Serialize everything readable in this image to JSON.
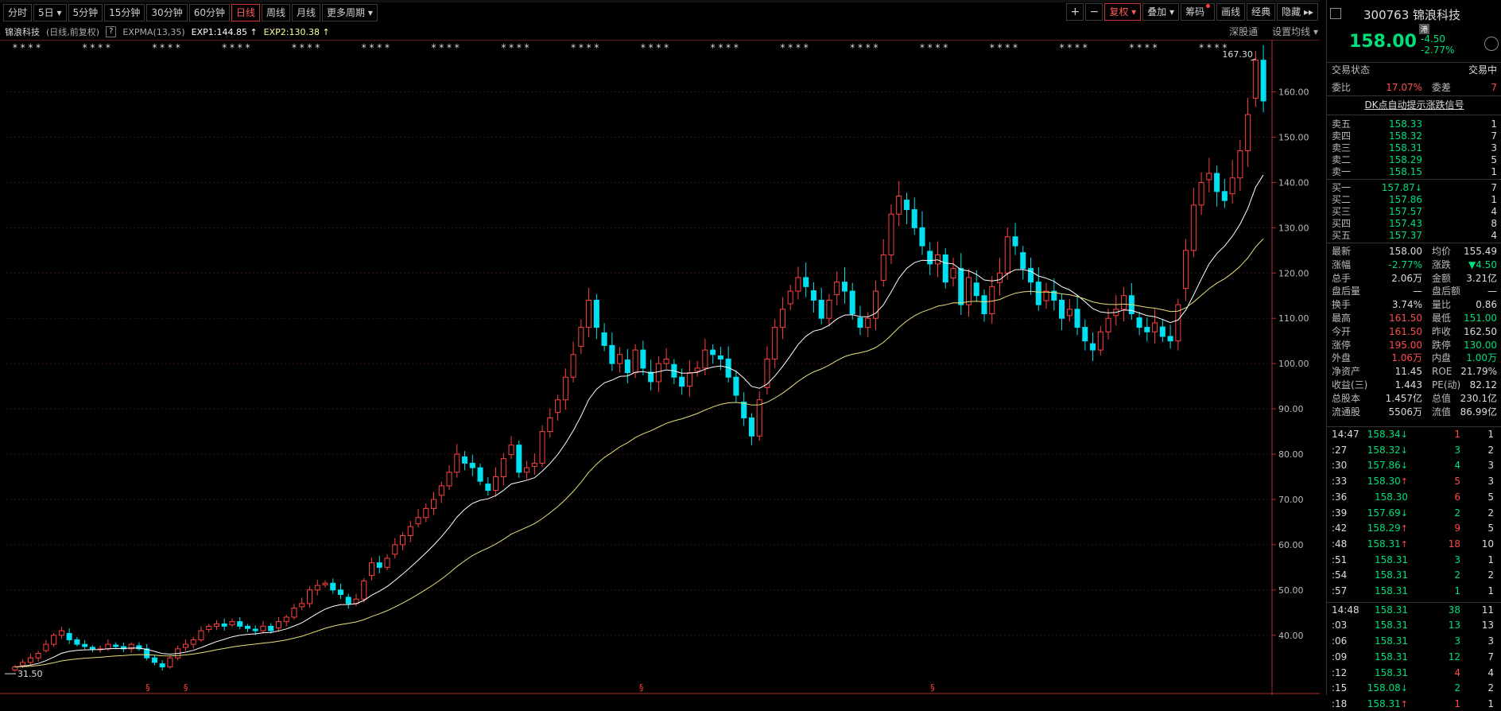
{
  "toolbar": {
    "periods": [
      "分时",
      "5日",
      "5分钟",
      "15分钟",
      "30分钟",
      "60分钟",
      "日线",
      "周线",
      "月线",
      "更多周期"
    ],
    "active_period": "日线",
    "right_buttons": [
      "复权",
      "叠加",
      "筹码",
      "画线",
      "经典",
      "隐藏"
    ]
  },
  "infobar": {
    "name": "锦浪科技",
    "meta": "(日线,前复权)",
    "help": "?",
    "indicator": "EXPMA(13,35)",
    "exp1": "EXP1:144.85",
    "exp2": "EXP2:130.38",
    "right_links": [
      "深股通",
      "设置均线"
    ]
  },
  "quote": {
    "code": "300763",
    "name": "锦浪科技",
    "hk_tag": "港",
    "price": "158.00",
    "change": "-4.50",
    "change_pct": "-2.77%"
  },
  "status": {
    "label": "交易状态",
    "value": "交易中"
  },
  "weibi": {
    "label1": "委比",
    "value1": "17.07%",
    "label2": "委差",
    "value2": "7"
  },
  "signal": "DK点自动提示涨跌信号",
  "sells": [
    {
      "label": "卖五",
      "price": "158.33",
      "vol": "1"
    },
    {
      "label": "卖四",
      "price": "158.32",
      "vol": "7"
    },
    {
      "label": "卖三",
      "price": "158.31",
      "vol": "3"
    },
    {
      "label": "卖二",
      "price": "158.29",
      "vol": "5"
    },
    {
      "label": "卖一",
      "price": "158.15",
      "vol": "1"
    }
  ],
  "buys": [
    {
      "label": "买一",
      "price": "157.87",
      "vol": "7",
      "arrow": "↓"
    },
    {
      "label": "买二",
      "price": "157.86",
      "vol": "1",
      "arrow": ""
    },
    {
      "label": "买三",
      "price": "157.57",
      "vol": "4",
      "arrow": ""
    },
    {
      "label": "买四",
      "price": "157.43",
      "vol": "8",
      "arrow": ""
    },
    {
      "label": "买五",
      "price": "157.37",
      "vol": "4",
      "arrow": ""
    }
  ],
  "stats": [
    [
      "最新",
      "158.00",
      "均价",
      "155.49"
    ],
    [
      "涨幅",
      "-2.77%",
      "涨跌",
      "▼4.50"
    ],
    [
      "总手",
      "2.06万",
      "金额",
      "3.21亿"
    ],
    [
      "盘后量",
      "—",
      "盘后额",
      "—"
    ],
    [
      "换手",
      "3.74%",
      "量比",
      "0.86"
    ],
    [
      "最高",
      "161.50",
      "最低",
      "151.00"
    ],
    [
      "今开",
      "161.50",
      "昨收",
      "162.50"
    ],
    [
      "涨停",
      "195.00",
      "跌停",
      "130.00"
    ],
    [
      "外盘",
      "1.06万",
      "内盘",
      "1.00万"
    ],
    [
      "净资产",
      "11.45",
      "ROE",
      "21.79%"
    ],
    [
      "收益(三)",
      "1.443",
      "PE(动)",
      "82.12"
    ],
    [
      "总股本",
      "1.457亿",
      "总值",
      "230.1亿"
    ],
    [
      "流通股",
      "5506万",
      "流值",
      "86.99亿"
    ]
  ],
  "stat_colors": [
    [
      "w",
      "w"
    ],
    [
      "g",
      "g"
    ],
    [
      "w",
      "w"
    ],
    [
      "w",
      "w"
    ],
    [
      "w",
      "w"
    ],
    [
      "r",
      "g"
    ],
    [
      "r",
      "w"
    ],
    [
      "r",
      "g"
    ],
    [
      "r",
      "g"
    ],
    [
      "w",
      "w"
    ],
    [
      "w",
      "w"
    ],
    [
      "w",
      "w"
    ],
    [
      "w",
      "w"
    ]
  ],
  "ticks1": [
    {
      "t": "14:47",
      "p": "158.34",
      "a": "↓",
      "v": "1",
      "n": "1",
      "pc": "g",
      "vc": "r"
    },
    {
      "t": ":27",
      "p": "158.32",
      "a": "↓",
      "v": "3",
      "n": "2",
      "pc": "g",
      "vc": "g"
    },
    {
      "t": ":30",
      "p": "157.86",
      "a": "↓",
      "v": "4",
      "n": "3",
      "pc": "g",
      "vc": "g"
    },
    {
      "t": ":33",
      "p": "158.30",
      "a": "↑",
      "v": "5",
      "n": "3",
      "pc": "g",
      "vc": "r"
    },
    {
      "t": ":36",
      "p": "158.30",
      "a": "",
      "v": "6",
      "n": "5",
      "pc": "g",
      "vc": "r"
    },
    {
      "t": ":39",
      "p": "157.69",
      "a": "↓",
      "v": "2",
      "n": "2",
      "pc": "g",
      "vc": "g"
    },
    {
      "t": ":42",
      "p": "158.29",
      "a": "↑",
      "v": "9",
      "n": "5",
      "pc": "g",
      "vc": "r"
    },
    {
      "t": ":48",
      "p": "158.31",
      "a": "↑",
      "v": "18",
      "n": "10",
      "pc": "g",
      "vc": "r"
    },
    {
      "t": ":51",
      "p": "158.31",
      "a": "",
      "v": "3",
      "n": "1",
      "pc": "g",
      "vc": "g"
    },
    {
      "t": ":54",
      "p": "158.31",
      "a": "",
      "v": "2",
      "n": "2",
      "pc": "g",
      "vc": "g"
    },
    {
      "t": ":57",
      "p": "158.31",
      "a": "",
      "v": "1",
      "n": "1",
      "pc": "g",
      "vc": "g"
    }
  ],
  "ticks2": [
    {
      "t": "14:48",
      "p": "158.31",
      "a": "",
      "v": "38",
      "n": "11",
      "pc": "g",
      "vc": "g"
    },
    {
      "t": ":03",
      "p": "158.31",
      "a": "",
      "v": "13",
      "n": "13",
      "pc": "g",
      "vc": "g"
    },
    {
      "t": ":06",
      "p": "158.31",
      "a": "",
      "v": "3",
      "n": "3",
      "pc": "g",
      "vc": "g"
    },
    {
      "t": ":09",
      "p": "158.31",
      "a": "",
      "v": "12",
      "n": "7",
      "pc": "g",
      "vc": "g"
    },
    {
      "t": ":12",
      "p": "158.31",
      "a": "",
      "v": "4",
      "n": "4",
      "pc": "g",
      "vc": "r"
    },
    {
      "t": ":15",
      "p": "158.08",
      "a": "↓",
      "v": "2",
      "n": "2",
      "pc": "g",
      "vc": "g"
    },
    {
      "t": ":18",
      "p": "158.31",
      "a": "↑",
      "v": "1",
      "n": "1",
      "pc": "g",
      "vc": "r"
    }
  ],
  "chart_data": {
    "type": "candlestick",
    "title": "锦浪科技",
    "yticks": [
      40,
      50,
      60,
      70,
      80,
      90,
      100,
      110,
      120,
      130,
      140,
      150,
      160
    ],
    "ylim": [
      31,
      168
    ],
    "high_label": "167.30",
    "low_label": "31.50",
    "closes": [
      33,
      34,
      35,
      36,
      38,
      40,
      41,
      39,
      38,
      37.5,
      37,
      37,
      38,
      37.5,
      37,
      38,
      37,
      35,
      34,
      33,
      35,
      37,
      38,
      39,
      41,
      42,
      42.5,
      42,
      43,
      42,
      41.5,
      41,
      42,
      41,
      43,
      44,
      46,
      47,
      50,
      51,
      51.5,
      50,
      49,
      47,
      48,
      52,
      56,
      55,
      57,
      60,
      62,
      64,
      66,
      68,
      70,
      73,
      76,
      80,
      78,
      77,
      74,
      72,
      75,
      79,
      82,
      76,
      77,
      78,
      85,
      88,
      92,
      97,
      102,
      108,
      114,
      108,
      104,
      100,
      102,
      98,
      103,
      99,
      96,
      100,
      101,
      97,
      95,
      98,
      99,
      103,
      102,
      101,
      97,
      93,
      88,
      84,
      92,
      101,
      108,
      112,
      116,
      119,
      117,
      114,
      110,
      114,
      118,
      116,
      111,
      108,
      110,
      116,
      124,
      133,
      137,
      134,
      130,
      126,
      122,
      124,
      118,
      121,
      113,
      119,
      115,
      111,
      117,
      120,
      128,
      126,
      121,
      118,
      113,
      116,
      114,
      110,
      112,
      108,
      105,
      103,
      107,
      110,
      112,
      115,
      111,
      108,
      107,
      109,
      106,
      105,
      113,
      125,
      135,
      140,
      142,
      138,
      136,
      141,
      147,
      155,
      167,
      158
    ]
  }
}
